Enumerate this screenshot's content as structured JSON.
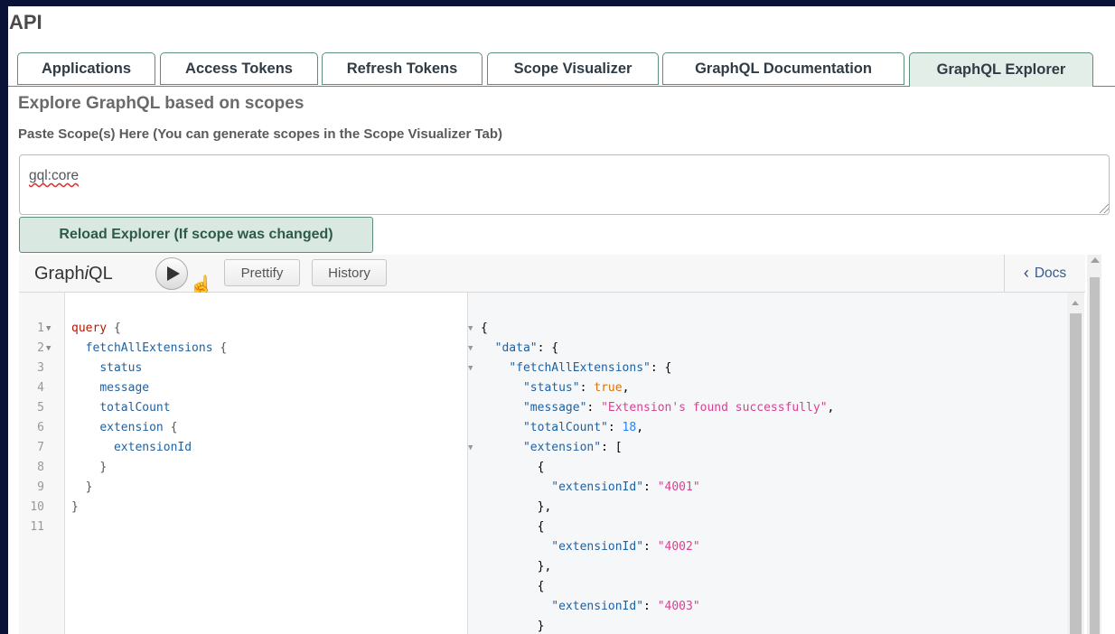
{
  "page": {
    "title": "API"
  },
  "tabs": [
    {
      "label": "Applications",
      "active": false
    },
    {
      "label": "Access Tokens",
      "active": false
    },
    {
      "label": "Refresh Tokens",
      "active": false
    },
    {
      "label": "Scope Visualizer",
      "active": false
    },
    {
      "label": "GraphQL Documentation",
      "active": false
    },
    {
      "label": "GraphQL Explorer",
      "active": true
    }
  ],
  "explorer": {
    "heading": "Explore GraphQL based on scopes",
    "scope_label": "Paste Scope(s) Here (You can generate scopes in the Scope Visualizer Tab)",
    "scope_value": "gql:core",
    "reload_label": "Reload Explorer (If scope was changed)"
  },
  "graphiql": {
    "logo_prefix": "Graph",
    "logo_italic": "i",
    "logo_suffix": "QL",
    "execute_icon": "play-icon",
    "prettify_label": "Prettify",
    "history_label": "History",
    "docs_label": "Docs"
  },
  "query_lines": [
    {
      "n": "1",
      "text": "query {"
    },
    {
      "n": "2",
      "text": "  fetchAllExtensions {"
    },
    {
      "n": "3",
      "text": "    status"
    },
    {
      "n": "4",
      "text": "    message"
    },
    {
      "n": "5",
      "text": "    totalCount"
    },
    {
      "n": "6",
      "text": "    extension {"
    },
    {
      "n": "7",
      "text": "      extensionId"
    },
    {
      "n": "8",
      "text": "    }"
    },
    {
      "n": "9",
      "text": "  }"
    },
    {
      "n": "10",
      "text": "}"
    },
    {
      "n": "11",
      "text": ""
    }
  ],
  "result_lines": [
    "{",
    "  \"data\": {",
    "    \"fetchAllExtensions\": {",
    "      \"status\": true,",
    "      \"message\": \"Extension's found successfully\",",
    "      \"totalCount\": 18,",
    "      \"extension\": [",
    "        {",
    "          \"extensionId\": \"4001\"",
    "        },",
    "        {",
    "          \"extensionId\": \"4002\"",
    "        },",
    "        {",
    "          \"extensionId\": \"4003\"",
    "        }"
  ],
  "colors": {
    "tab_border": "#5b8f7a",
    "active_tab": "#e4eee9",
    "reload_button": "#d9e9e1",
    "keyword": "#b11a04",
    "field": "#1f61a0",
    "string": "#d64292",
    "number": "#2882f9",
    "boolean": "#d47509"
  }
}
